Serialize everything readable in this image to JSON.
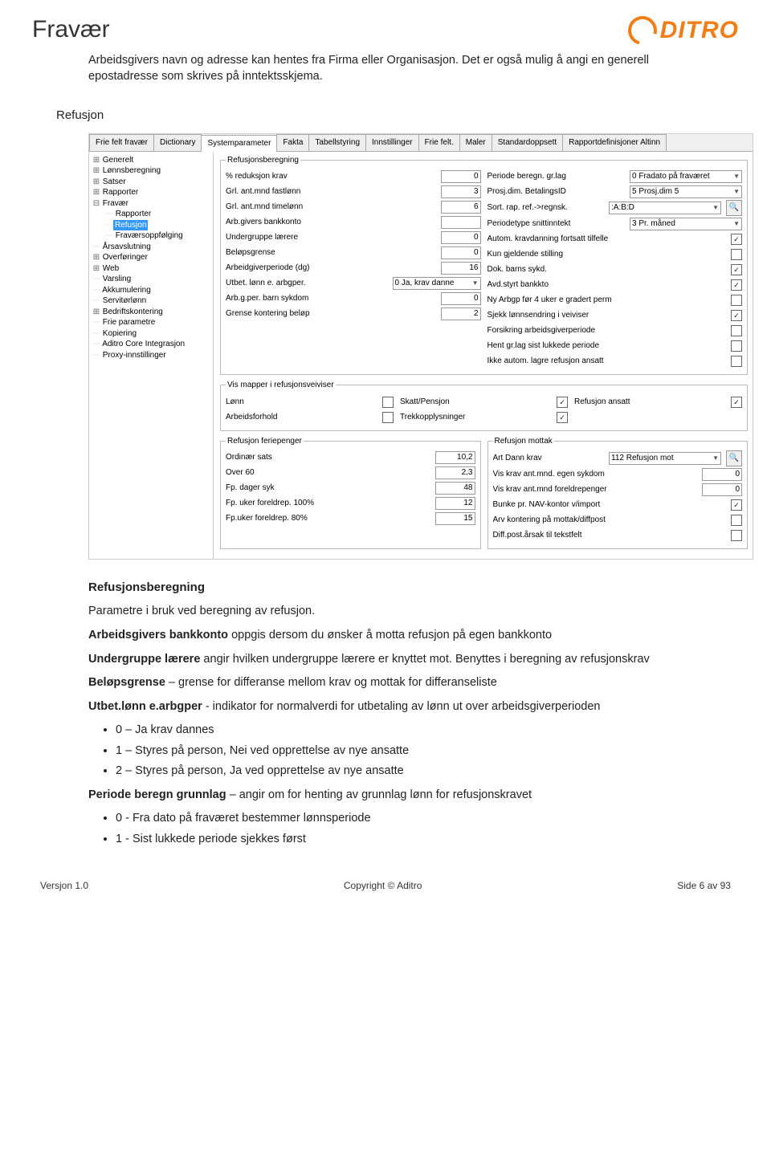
{
  "header": {
    "title": "Fravær",
    "logo_text": "DITRO"
  },
  "intro_paragraph": "Arbeidsgivers navn og adresse kan hentes fra Firma eller Organisasjon. Det er også mulig å angi en generell epostadresse som skrives på inntektsskjema.",
  "section_heading": "Refusjon",
  "screenshot": {
    "tabs": [
      "Frie felt fravær",
      "Dictionary",
      "Systemparameter",
      "Fakta",
      "Tabellstyring",
      "Innstillinger",
      "Frie felt.",
      "Maler",
      "Standardoppsett",
      "Rapportdefinisjoner Altinn"
    ],
    "active_tab_index": 2,
    "tree": [
      {
        "l": "Generelt",
        "d": 0,
        "exp": "+"
      },
      {
        "l": "Lønnsberegning",
        "d": 0,
        "exp": "+"
      },
      {
        "l": "Satser",
        "d": 0,
        "exp": "+"
      },
      {
        "l": "Rapporter",
        "d": 0,
        "exp": "+"
      },
      {
        "l": "Fravær",
        "d": 0,
        "exp": "-"
      },
      {
        "l": "Rapporter",
        "d": 1
      },
      {
        "l": "Refusjon",
        "d": 1,
        "sel": true
      },
      {
        "l": "Fraværsoppfølging",
        "d": 1
      },
      {
        "l": "Årsavslutning",
        "d": 0
      },
      {
        "l": "Overføringer",
        "d": 0,
        "exp": "+"
      },
      {
        "l": "Web",
        "d": 0,
        "exp": "+"
      },
      {
        "l": "Varsling",
        "d": 0
      },
      {
        "l": "Akkumulering",
        "d": 0
      },
      {
        "l": "Servitørlønn",
        "d": 0
      },
      {
        "l": "Bedriftskontering",
        "d": 0,
        "exp": "+"
      },
      {
        "l": "Frie parametre",
        "d": 0
      },
      {
        "l": "Kopiering",
        "d": 0
      },
      {
        "l": "Aditro Core Integrasjon",
        "d": 0
      },
      {
        "l": "Proxy-innstillinger",
        "d": 0
      }
    ],
    "refusjonsberegning": {
      "legend": "Refusjonsberegning",
      "left": [
        {
          "label": "% reduksjon krav",
          "value": "0"
        },
        {
          "label": "Grl. ant.mnd fastlønn",
          "value": "3"
        },
        {
          "label": "Grl. ant.mnd timelønn",
          "value": "6"
        },
        {
          "label": "Arb.givers bankkonto",
          "value": ""
        },
        {
          "label": "Undergruppe lærere",
          "value": "0"
        },
        {
          "label": "Beløpsgrense",
          "value": "0"
        },
        {
          "label": "Arbeidgiverperiode (dg)",
          "value": "16"
        },
        {
          "label": "Utbet. lønn e. arbgper.",
          "combo": "0 Ja, krav danne"
        },
        {
          "label": "Arb.g.per. barn sykdom",
          "value": "0"
        },
        {
          "label": "Grense kontering beløp",
          "value": "2"
        }
      ],
      "right_combo": [
        {
          "label": "Periode beregn. gr.lag",
          "combo": "0 Fradato på fraværet"
        },
        {
          "label": "Prosj.dim. BetalingsID",
          "combo": "5 Prosj.dim 5"
        },
        {
          "label": "Sort. rap. ref.->regnsk.",
          "combo": ":A:B:D",
          "btn": true
        },
        {
          "label": "Periodetype snittinntekt",
          "combo": "3 Pr. måned"
        }
      ],
      "right_chk": [
        {
          "label": "Autom. kravdanning fortsatt tilfelle",
          "checked": true
        },
        {
          "label": "Kun gjeldende stilling",
          "checked": false
        },
        {
          "label": "Dok. barns sykd.",
          "checked": true
        },
        {
          "label": "Avd.styrt bankkto",
          "checked": true
        },
        {
          "label": "Ny Arbgp før 4 uker e gradert perm",
          "checked": false
        },
        {
          "label": "Sjekk lønnsendring i veiviser",
          "checked": true
        },
        {
          "label": "Forsikring arbeidsgiverperiode",
          "checked": false
        },
        {
          "label": "Hent gr.lag sist lukkede periode",
          "checked": false
        },
        {
          "label": "Ikke autom. lagre refusjon ansatt",
          "checked": false
        }
      ]
    },
    "vismapper": {
      "legend": "Vis mapper i refusjonsveiviser",
      "left": [
        {
          "label": "Lønn",
          "checked": false
        },
        {
          "label": "Arbeidsforhold",
          "checked": false
        }
      ],
      "mid": [
        {
          "label": "Skatt/Pensjon",
          "checked": true
        },
        {
          "label": "Trekkopplysninger",
          "checked": true
        }
      ],
      "right": [
        {
          "label": "Refusjon ansatt",
          "checked": true
        }
      ]
    },
    "feriepenger": {
      "legend": "Refusjon feriepenger",
      "rows": [
        {
          "label": "Ordinær sats",
          "value": "10,2"
        },
        {
          "label": "Over 60",
          "value": "2,3"
        },
        {
          "label": "Fp. dager syk",
          "value": "48"
        },
        {
          "label": "Fp. uker foreldrep. 100%",
          "value": "12"
        },
        {
          "label": "Fp.uker foreldrep. 80%",
          "value": "15"
        }
      ]
    },
    "mottak": {
      "legend": "Refusjon mottak",
      "combo": {
        "label": "Art Dann krav",
        "value": "112 Refusjon mot",
        "btn": true
      },
      "vals": [
        {
          "label": "Vis krav ant.mnd. egen sykdom",
          "value": "0"
        },
        {
          "label": "Vis krav ant.mnd foreldrepenger",
          "value": "0"
        }
      ],
      "chk": [
        {
          "label": "Bunke pr. NAV-kontor v/import",
          "checked": true
        },
        {
          "label": "Arv kontering på mottak/diffpost",
          "checked": false
        },
        {
          "label": "Diff.post.årsak til tekstfelt",
          "checked": false
        }
      ]
    }
  },
  "body": {
    "h1": "Refusjonsberegning",
    "p1": "Parametre i bruk ved beregning av refusjon.",
    "p2a": "Arbeidsgivers bankkonto",
    "p2b": " oppgis dersom du ønsker å motta refusjon på egen bankkonto",
    "p3a": "Undergruppe lærere",
    "p3b": " angir hvilken undergruppe lærere er knyttet mot. Benyttes i beregning av refusjonskrav",
    "p4a": "Beløpsgrense",
    "p4b": " – grense for differanse mellom krav og mottak for differanseliste",
    "p5a": "Utbet.lønn e.arbgper",
    "p5b": " - indikator for normalverdi for utbetaling av lønn ut over arbeidsgiverperioden",
    "list1": [
      "0 – Ja krav dannes",
      "1 – Styres på person, Nei ved opprettelse av nye ansatte",
      "2 – Styres på person, Ja ved opprettelse av nye ansatte"
    ],
    "p6a": "Periode beregn grunnlag",
    "p6b": " – angir om for henting av grunnlag lønn for refusjonskravet",
    "list2": [
      "0 - Fra dato på fraværet bestemmer lønnsperiode",
      "1 - Sist lukkede periode sjekkes først"
    ]
  },
  "footer": {
    "left": "Versjon 1.0",
    "center": "Copyright © Aditro",
    "right": "Side 6 av 93"
  }
}
